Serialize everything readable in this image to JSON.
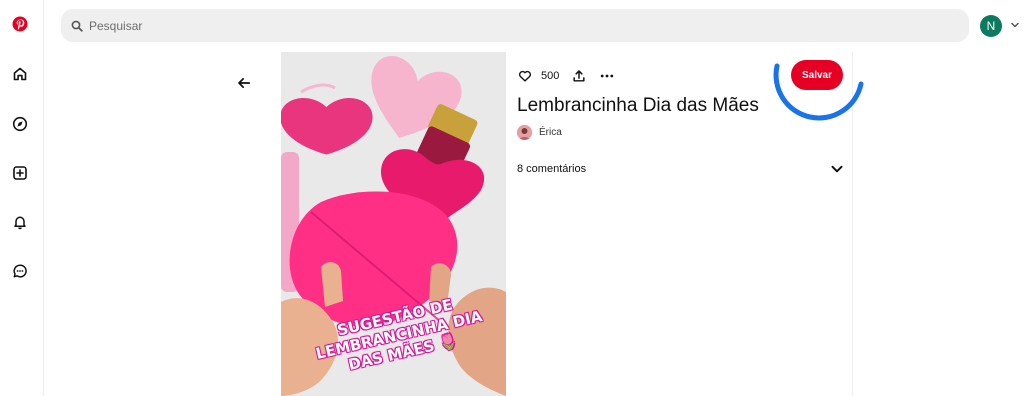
{
  "search": {
    "placeholder": "Pesquisar"
  },
  "user": {
    "avatar_initial": "N"
  },
  "pin": {
    "overlay_text": "SUGESTÃO DE LEMBRANCINHA DIA DAS MÃES 🌷",
    "like_count": "500",
    "save_label": "Salvar",
    "title": "Lembrancinha Dia das Mães",
    "author": "Érica",
    "comments_label": "8 comentários"
  },
  "colors": {
    "brand": "#e60023",
    "avatar_bg": "#0b7a5e",
    "highlight_ring": "#1a73e8"
  },
  "icons": {
    "sidebar": [
      "pinterest-logo-icon",
      "home-icon",
      "explore-compass-icon",
      "create-plus-icon",
      "notifications-bell-icon",
      "messages-chat-icon"
    ],
    "back": "arrow-left-icon",
    "like": "heart-icon",
    "share": "share-upload-icon",
    "more": "more-dots-icon",
    "expand": "chevron-down-icon"
  }
}
